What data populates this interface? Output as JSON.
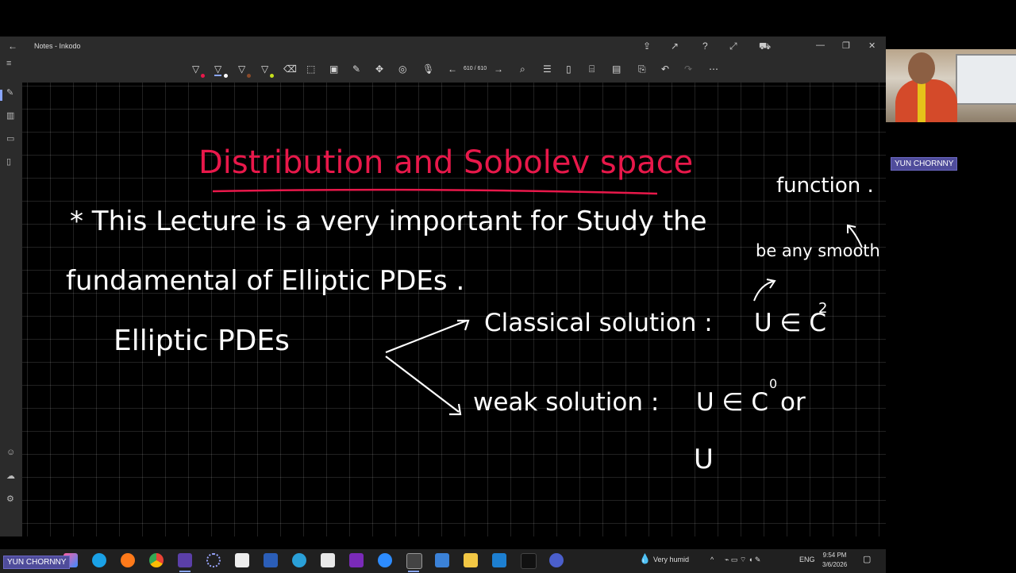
{
  "window": {
    "title": "Notes - Inkodo"
  },
  "toolbar": {
    "page_indicator": "610 / 610"
  },
  "notes": {
    "title": "Distribution and Sobolev space",
    "line1": "* This Lecture is a very important for Study the",
    "line2": "fundamental of Elliptic PDEs .",
    "elliptic": "Elliptic PDEs",
    "classical": "Classical solution :",
    "classical_space": "U ∈ C",
    "classical_exp": "2",
    "weak": "weak solution :",
    "weak_space": "U ∈ C",
    "weak_exp": "0",
    "weak_or": "or",
    "u_partial": "U",
    "margin_function": "function .",
    "margin_smooth": "be any smooth"
  },
  "taskbar": {
    "weather": "Very humid",
    "lang": "ENG",
    "time": "9:54 PM",
    "date": "3/6/2026"
  },
  "participants": {
    "webcam_name": "YUN CHORNNY",
    "bottom_name": "YUN CHORNNY"
  },
  "colors": {
    "ink_red": "#e8184a",
    "ink_white": "#ffffff",
    "accent": "#8aa6ff",
    "name_tag": "#4f4c9b"
  }
}
